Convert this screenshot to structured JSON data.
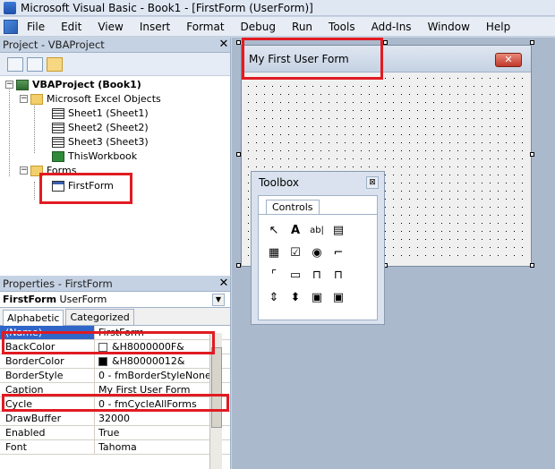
{
  "window": {
    "title": "Microsoft Visual Basic - Book1 - [FirstForm (UserForm)]"
  },
  "menu": {
    "items": [
      {
        "label": "File"
      },
      {
        "label": "Edit"
      },
      {
        "label": "View"
      },
      {
        "label": "Insert"
      },
      {
        "label": "Format"
      },
      {
        "label": "Debug"
      },
      {
        "label": "Run"
      },
      {
        "label": "Tools"
      },
      {
        "label": "Add-Ins"
      },
      {
        "label": "Window"
      },
      {
        "label": "Help"
      }
    ]
  },
  "project": {
    "title": "Project - VBAProject",
    "close_glyph": "✕",
    "tree": {
      "root": "VBAProject (Book1)",
      "excel_objects": "Microsoft Excel Objects",
      "sheet1": "Sheet1 (Sheet1)",
      "sheet2": "Sheet2 (Sheet2)",
      "sheet3": "Sheet3 (Sheet3)",
      "workbook": "ThisWorkbook",
      "forms": "Forms",
      "first_form": "FirstForm",
      "collapse_glyph": "−"
    }
  },
  "properties": {
    "title": "Properties - FirstForm",
    "close_glyph": "✕",
    "object_name": "FirstForm",
    "object_type": "UserForm",
    "tabs": {
      "alphabetic": "Alphabetic",
      "categorized": "Categorized"
    },
    "rows": [
      {
        "name": "(Name)",
        "value": "FirstForm"
      },
      {
        "name": "BackColor",
        "value": "&H8000000F&"
      },
      {
        "name": "BorderColor",
        "value": "&H80000012&"
      },
      {
        "name": "BorderStyle",
        "value": "0 - fmBorderStyleNone"
      },
      {
        "name": "Caption",
        "value": "My First User Form"
      },
      {
        "name": "Cycle",
        "value": "0 - fmCycleAllForms"
      },
      {
        "name": "DrawBuffer",
        "value": "32000"
      },
      {
        "name": "Enabled",
        "value": "True"
      },
      {
        "name": "Font",
        "value": "Tahoma"
      }
    ],
    "colors": {
      "backcolor_swatch": "#ffffff",
      "bordercolor_swatch": "#000000"
    }
  },
  "form": {
    "caption": "My First User Form",
    "close_glyph": "✕"
  },
  "toolbox": {
    "title": "Toolbox",
    "close_glyph": "⊠",
    "tab": "Controls",
    "tools": [
      {
        "icon": "pointer-icon",
        "glyph": "↖"
      },
      {
        "icon": "label-icon",
        "glyph": "A"
      },
      {
        "icon": "textbox-icon",
        "glyph": "ab|"
      },
      {
        "icon": "combobox-icon",
        "glyph": "▤"
      },
      {
        "icon": "listbox-icon",
        "glyph": "▦"
      },
      {
        "icon": "checkbox-icon",
        "glyph": "☑"
      },
      {
        "icon": "optionbutton-icon",
        "glyph": "◉"
      },
      {
        "icon": "togglebutton-icon",
        "glyph": "⌐"
      },
      {
        "icon": "frame-icon",
        "glyph": "⌜"
      },
      {
        "icon": "commandbutton-icon",
        "glyph": "▭"
      },
      {
        "icon": "tabstrip-icon",
        "glyph": "⊓"
      },
      {
        "icon": "multipage-icon",
        "glyph": "⊓"
      },
      {
        "icon": "scrollbar-icon",
        "glyph": "⇕"
      },
      {
        "icon": "spinbutton-icon",
        "glyph": "⬍"
      },
      {
        "icon": "image-icon",
        "glyph": "▣"
      },
      {
        "icon": "refedit-icon",
        "glyph": "▣"
      }
    ]
  },
  "colors": {
    "highlight": "#e11b22"
  }
}
